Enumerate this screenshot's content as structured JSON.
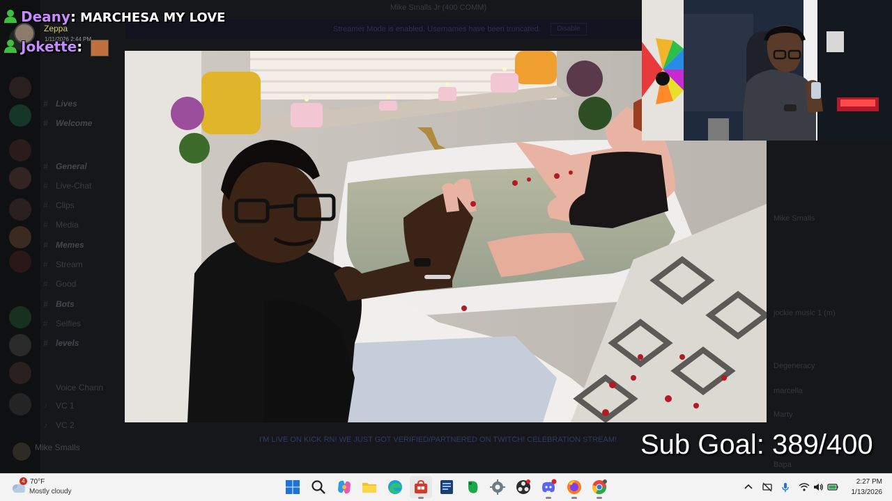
{
  "discord": {
    "dm_header": "Mike Smalls Jr (400 COMM)",
    "notice_text": "Streamer Mode is enabled. Usernames have been truncated.",
    "notice_button": "Disable",
    "channels": [
      {
        "label": "Lives",
        "category": true
      },
      {
        "label": "Welcome",
        "category": true
      },
      {
        "label": "General",
        "category": true
      },
      {
        "label": "Live-Chat",
        "category": false
      },
      {
        "label": "Clips",
        "category": false
      },
      {
        "label": "Media",
        "category": false
      },
      {
        "label": "Memes",
        "category": true
      },
      {
        "label": "Stream",
        "category": false
      },
      {
        "label": "Good",
        "category": false
      },
      {
        "label": "Bots",
        "category": true
      },
      {
        "label": "Selfies",
        "category": false
      },
      {
        "label": "levels",
        "category": true
      },
      {
        "label": "Voice Chann",
        "category": false
      },
      {
        "label": "VC 1",
        "category": false
      },
      {
        "label": "VC 2",
        "category": false
      }
    ],
    "user_name": "Mike Smalls",
    "members": [
      "Mike Smalls",
      "jockie music 1 (m)",
      "Degeneracy",
      "marcella",
      "Marty",
      "Bapa"
    ],
    "bottom_message": "I'M LIVE ON KICK RN! WE JUST GOT VERIFIED/PARTNERED ON TWITCH! CELEBRATION STREAM!"
  },
  "chat": {
    "messages": [
      {
        "user": "Deany",
        "text": "MARCHESA MY LOVE"
      },
      {
        "user": "Jokette",
        "text": ""
      }
    ],
    "popup_name": "Zeppa",
    "popup_time": "1/11/2026 2:44 PM"
  },
  "overlay": {
    "sub_goal": "Sub Goal: 389/400",
    "sub_goal_current": 389,
    "sub_goal_target": 400
  },
  "taskbar": {
    "weather_badge": "4",
    "weather_temp": "70°F",
    "weather_desc": "Mostly cloudy",
    "time": "2:27 PM",
    "date": "1/13/2026",
    "apps": [
      "start-icon",
      "search-icon",
      "copilot-icon",
      "file-explorer-icon",
      "edge-icon",
      "store-icon",
      "text-editor-icon",
      "evernote-icon",
      "settings-icon",
      "obs-icon",
      "discord-icon",
      "firefox-icon",
      "chrome-icon"
    ]
  },
  "colors": {
    "chat_username": "#c68cff",
    "sub_badge": "#3fbf3f",
    "taskbar_bg": "#f3f3f3"
  }
}
